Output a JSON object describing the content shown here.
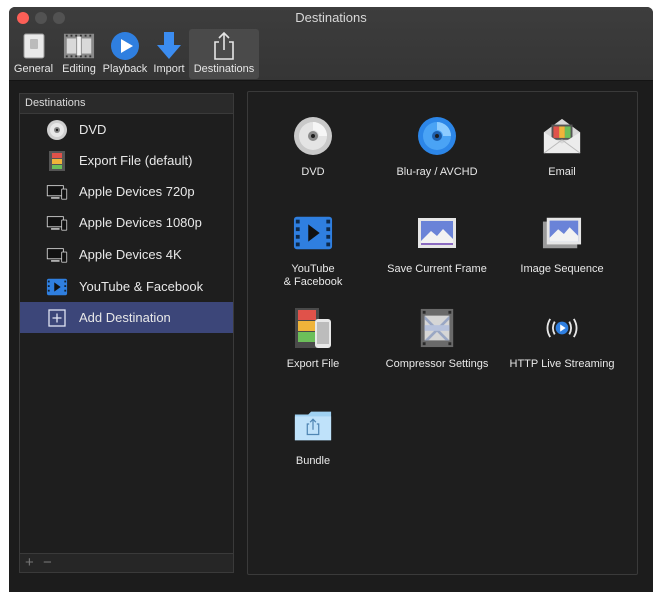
{
  "window": {
    "title": "Destinations"
  },
  "toolbar": {
    "items": [
      {
        "label": "General",
        "icon": "switch-icon"
      },
      {
        "label": "Editing",
        "icon": "filmstrip-icon"
      },
      {
        "label": "Playback",
        "icon": "play-icon"
      },
      {
        "label": "Import",
        "icon": "download-arrow-icon"
      },
      {
        "label": "Destinations",
        "icon": "share-icon",
        "selected": true
      }
    ]
  },
  "sidebar": {
    "header": "Destinations",
    "items": [
      {
        "label": "DVD",
        "icon": "dvd-icon"
      },
      {
        "label": "Export File (default)",
        "icon": "film-file-icon"
      },
      {
        "label": "Apple Devices 720p",
        "icon": "devices-icon"
      },
      {
        "label": "Apple Devices 1080p",
        "icon": "devices-icon"
      },
      {
        "label": "Apple Devices 4K",
        "icon": "devices-icon"
      },
      {
        "label": "YouTube & Facebook",
        "icon": "video-icon"
      },
      {
        "label": "Add Destination",
        "icon": "add-icon",
        "selected": true
      }
    ],
    "footer": {
      "add": "+",
      "remove": "−"
    }
  },
  "destinations_grid": {
    "items": [
      {
        "label": "DVD",
        "icon": "dvd-icon"
      },
      {
        "label": "Blu-ray / AVCHD",
        "icon": "bluray-icon"
      },
      {
        "label": "Email",
        "icon": "email-icon"
      },
      {
        "label": "YouTube\n& Facebook",
        "icon": "video-icon"
      },
      {
        "label": "Save Current Frame",
        "icon": "image-icon"
      },
      {
        "label": "Image Sequence",
        "icon": "image-stack-icon"
      },
      {
        "label": "Export File",
        "icon": "export-file-icon"
      },
      {
        "label": "Compressor Settings",
        "icon": "compressor-icon"
      },
      {
        "label": "HTTP Live Streaming",
        "icon": "streaming-icon"
      },
      {
        "label": "Bundle",
        "icon": "folder-share-icon"
      }
    ]
  },
  "colors": {
    "selection": "#3c4679",
    "close": "#fc5f57",
    "accent_blue": "#2f7fe0"
  }
}
